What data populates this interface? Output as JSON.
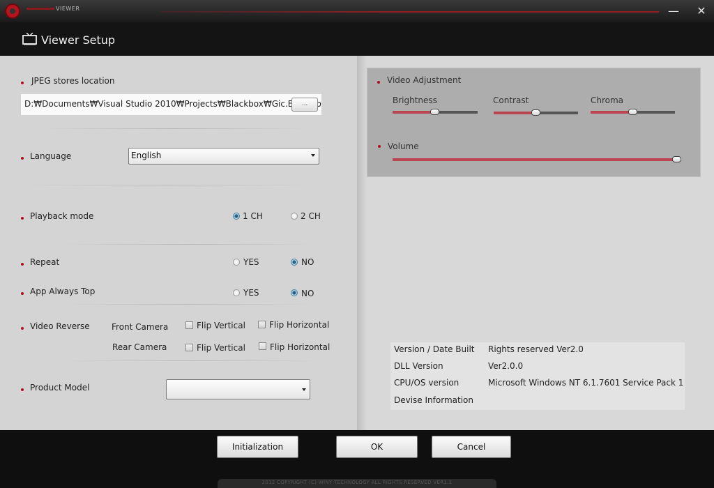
{
  "titlebar": {
    "app_name": "VIEWER",
    "minimize_label": "—",
    "close_label": "✕"
  },
  "header": {
    "title": "Viewer Setup",
    "icon": "tv-icon"
  },
  "settings": {
    "jpeg_location": {
      "label": "JPEG stores location",
      "path": "D:₩Documents₩Visual Studio 2010₩Projects₩Blackbox₩Gic.BlackBo",
      "browse_label": "..."
    },
    "language": {
      "label": "Language",
      "selected": "English"
    },
    "playback_mode": {
      "label": "Playback mode",
      "options": [
        {
          "label": "1 CH",
          "checked": true
        },
        {
          "label": "2 CH",
          "checked": false
        }
      ]
    },
    "repeat": {
      "label": "Repeat",
      "options": [
        {
          "label": "YES",
          "checked": false
        },
        {
          "label": "NO",
          "checked": true
        }
      ]
    },
    "app_always_top": {
      "label": "App Always Top",
      "options": [
        {
          "label": "YES",
          "checked": false
        },
        {
          "label": "NO",
          "checked": true
        }
      ]
    },
    "video_reverse": {
      "label": "Video Reverse",
      "front_camera": {
        "label": "Front Camera",
        "flip_vertical": "Flip Vertical",
        "flip_horizontal": "Flip Horizontal",
        "vertical_checked": false,
        "horizontal_checked": false
      },
      "rear_camera": {
        "label": "Rear Camera",
        "flip_vertical": "Flip Vertical",
        "flip_horizontal": "Flip Horizontal",
        "vertical_checked": false,
        "horizontal_checked": false
      }
    },
    "product_model": {
      "label": "Product Model",
      "selected": ""
    }
  },
  "video_adjustment": {
    "label": "Video Adjustment",
    "brightness": {
      "label": "Brightness",
      "value_pct": 50
    },
    "contrast": {
      "label": "Contrast",
      "value_pct": 50
    },
    "chroma": {
      "label": "Chroma",
      "value_pct": 50
    },
    "volume": {
      "label": "Volume",
      "value_pct": 100
    }
  },
  "info": {
    "rows": [
      {
        "key": "Version / Date Built",
        "value": "Rights reserved Ver2.0"
      },
      {
        "key": "DLL Version",
        "value": "Ver2.0.0"
      },
      {
        "key": "CPU/OS version",
        "value": "Microsoft Windows NT 6.1.7601 Service Pack 1"
      },
      {
        "key": "Devise Information",
        "value": ""
      }
    ]
  },
  "footer": {
    "init_label": "Initialization",
    "ok_label": "OK",
    "cancel_label": "Cancel",
    "copyright": "2012 COPYRIGHT (C) WINY TECHNOLOGY ALL RIGHTS RESERVED VER1.1"
  },
  "colors": {
    "accent": "#b01020",
    "slider_fill": "#b84550"
  }
}
